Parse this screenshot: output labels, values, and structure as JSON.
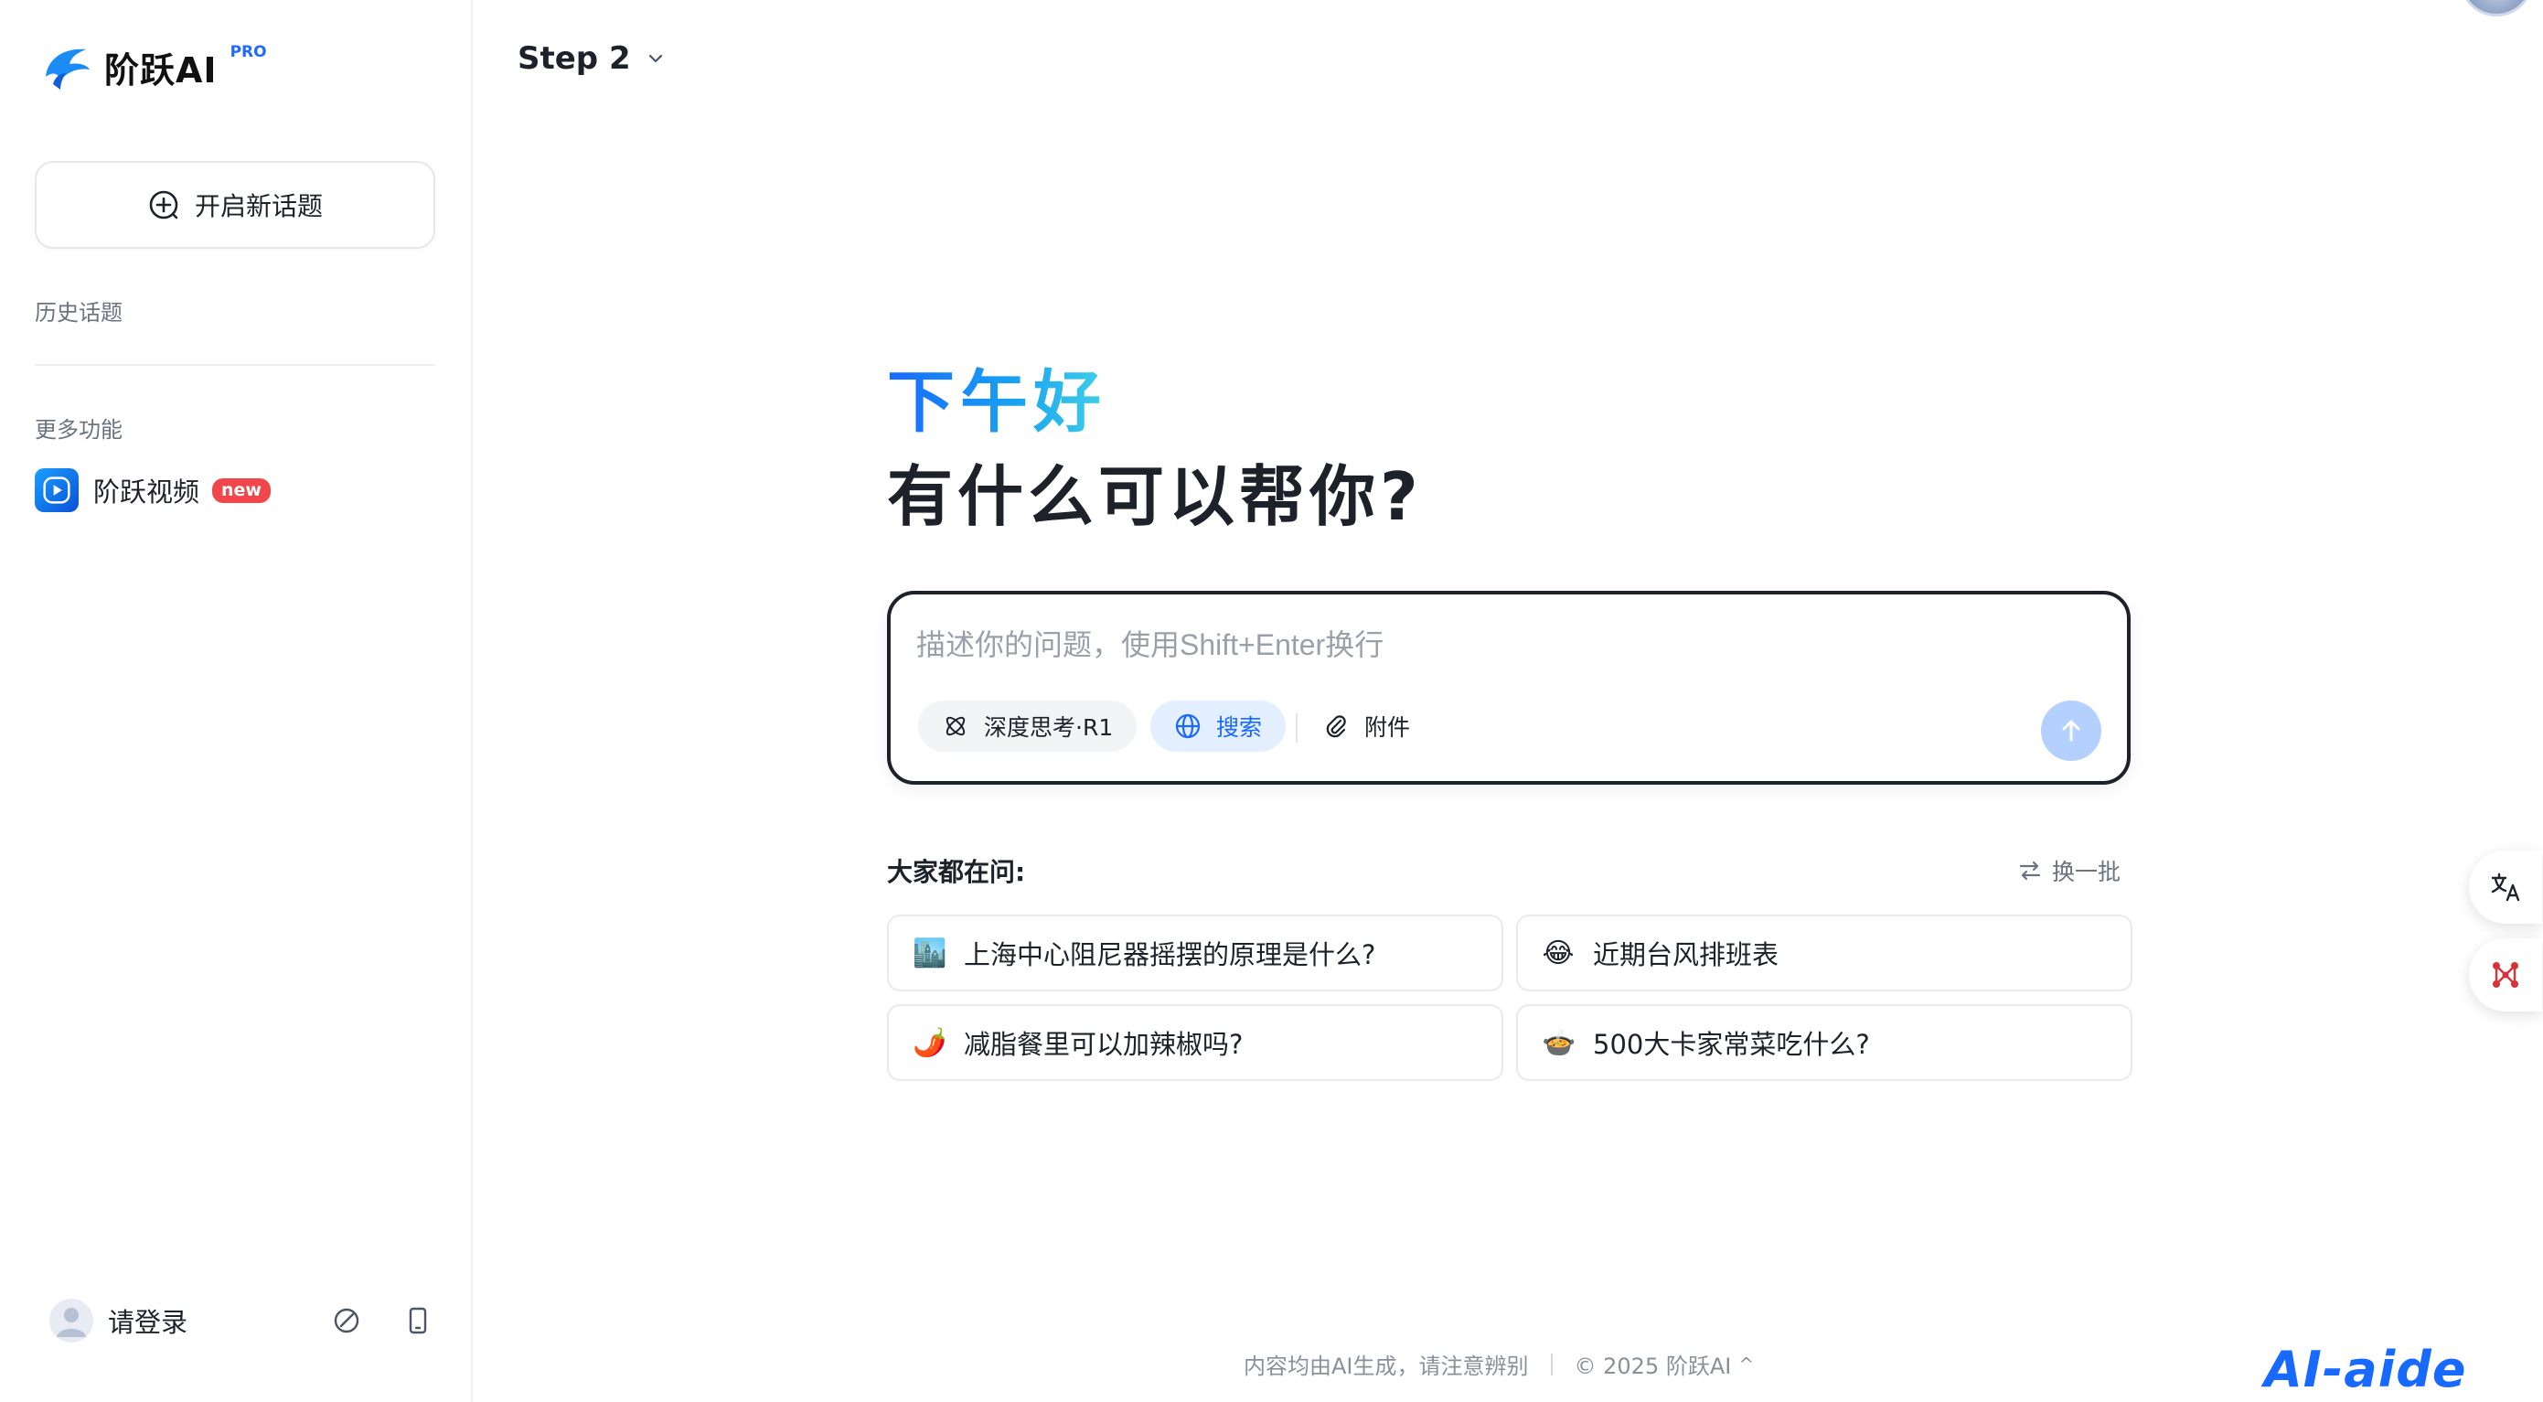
{
  "brand": {
    "name": "阶跃AI",
    "tier": "PRO"
  },
  "sidebar": {
    "new_topic_label": "开启新话题",
    "history_label": "历史话题",
    "more_label": "更多功能",
    "features": [
      {
        "label": "阶跃视频",
        "badge": "new"
      }
    ],
    "login_label": "请登录"
  },
  "header": {
    "model": "Step 2"
  },
  "greeting": {
    "line1": "下午好",
    "line2": "有什么可以帮你?"
  },
  "input": {
    "placeholder": "描述你的问题，使用Shift+Enter换行",
    "value": "",
    "chips": {
      "think": "深度思考·R1",
      "search": "搜索",
      "attach": "附件"
    }
  },
  "popular": {
    "title": "大家都在问:",
    "refresh_label": "换一批",
    "questions": [
      {
        "emoji": "🏙️",
        "text": "上海中心阻尼器摇摆的原理是什么?"
      },
      {
        "emoji": "😂",
        "text": "近期台风排班表"
      },
      {
        "emoji": "🌶️",
        "text": "减脂餐里可以加辣椒吗?"
      },
      {
        "emoji": "🍲",
        "text": "500大卡家常菜吃什么?"
      }
    ]
  },
  "footer": {
    "disclaimer": "内容均由AI生成，请注意辨别",
    "copyright": "© 2025 阶跃AI",
    "caret": "^"
  },
  "watermark": "AI-aide",
  "colors": {
    "accent": "#1769ff",
    "send_disabled": "#b3d0ff",
    "badge": "#f0464c"
  }
}
